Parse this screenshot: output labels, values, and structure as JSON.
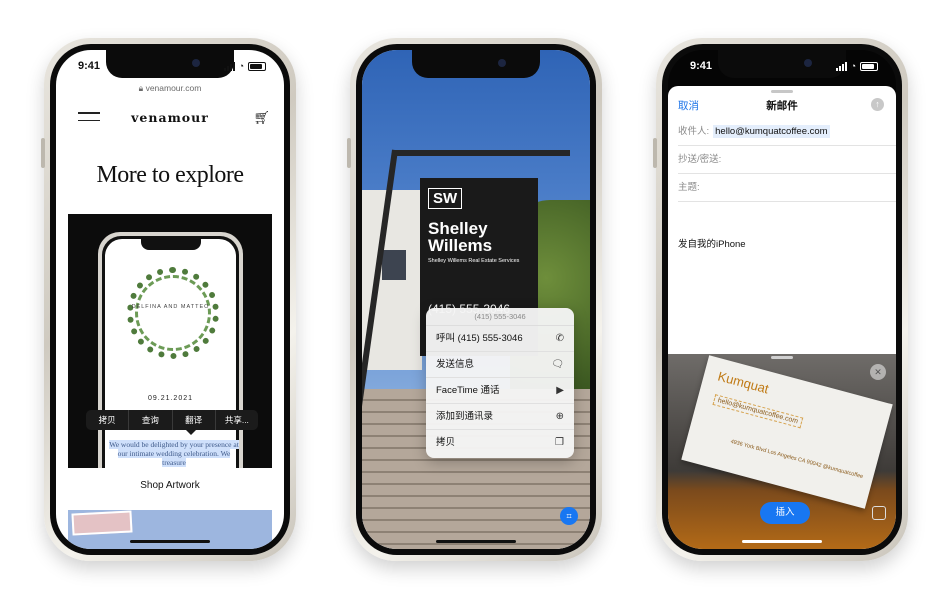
{
  "phone1": {
    "time": "9:41",
    "url": "venamour.com",
    "brand": "venamour",
    "heading": "More to explore",
    "invite_names": "DELFINA AND MATTEO",
    "invite_date": "09.21.2021",
    "context_menu": [
      "拷贝",
      "查询",
      "翻译",
      "共享..."
    ],
    "selected_text": "We would be delighted by your presence at our intimate wedding celebration. We treasure",
    "shop_label": "Shop Artwork"
  },
  "phone2": {
    "sign_initials": "SW",
    "sign_name": "Shelley Willems",
    "sign_sub": "Shelley Willems Real Estate Services",
    "sign_phone": "(415) 555-3046",
    "popup": {
      "header": "(415) 555-3046",
      "items": [
        {
          "label": "呼叫 (415) 555-3046",
          "icon": "phone-icon"
        },
        {
          "label": "发送信息",
          "icon": "message-icon"
        },
        {
          "label": "FaceTime 通话",
          "icon": "video-icon"
        },
        {
          "label": "添加到通讯录",
          "icon": "contact-add-icon"
        },
        {
          "label": "拷贝",
          "icon": "copy-icon"
        }
      ]
    }
  },
  "phone3": {
    "time": "9:41",
    "cancel": "取消",
    "title": "新邮件",
    "to_label": "收件人:",
    "to_value": "hello@kumquatcoffee.com",
    "cc_label": "抄送/密送:",
    "subject_label": "主题:",
    "body": "发自我的iPhone",
    "card_brand": "Kumquat",
    "card_email": "hello@kumquatcoffee.com",
    "card_address": "4936 York Blvd Los Angeles CA 90042 @kumquatcoffee",
    "insert_button": "插入"
  },
  "colors": {
    "accent": "#1877f2",
    "selection": "#cfe0fb"
  }
}
